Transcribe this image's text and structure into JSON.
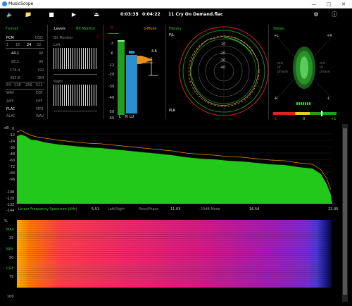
{
  "app": {
    "title": "MusicScope"
  },
  "toolbar": {
    "position": "0:03:35",
    "separator": "/",
    "duration": "0:04:22",
    "track": "11 Cry On Demand.flac"
  },
  "format": {
    "label": "Format",
    "pcm": "PCM",
    "dsd": "DSD",
    "bits": [
      "1",
      "16",
      "24",
      "32"
    ],
    "rates_left": [
      "44.1",
      "88.2",
      "176.4",
      "352.8"
    ],
    "rates_right": [
      "48",
      "96",
      "192",
      "384"
    ],
    "dsd_rates": [
      "64",
      "128",
      "256",
      "512"
    ],
    "containers_left": [
      "WAV",
      "AIFF",
      "FLAC",
      "ALAC"
    ],
    "containers_right": [
      "DSF",
      "DFF",
      "MP3",
      "WAV"
    ]
  },
  "levels": {
    "label": "Levels",
    "bit_monitor": "Bit Monitor",
    "bit_monitor_sub": "Bit Monitor",
    "left": "Left",
    "right": "Right",
    "meter_label": "S-Mode",
    "meter_ticks": [
      "0",
      "-3",
      "-6",
      "-12",
      "-20",
      "-30",
      "-40",
      "-50",
      "-60"
    ],
    "peak_value": "4.6",
    "channels": [
      "L",
      "R",
      "LU"
    ]
  },
  "history": {
    "label": "History",
    "pl": "P/L",
    "plr": "PLR",
    "rings": [
      "10",
      "-20",
      "-30",
      "-40"
    ]
  },
  "stereo": {
    "label": "Stereo",
    "plus_l": "+L",
    "plus_r": "+R",
    "minus_r": "-R",
    "minus_l": "-L",
    "out_left": "out of phase",
    "out_right": "out of phase",
    "corr_min": "-1",
    "corr_mid": "0",
    "corr_max": "+1"
  },
  "spectrum": {
    "y_unit": "dB",
    "y_ticks": [
      "0",
      "-12",
      "-24",
      "-36",
      "-48",
      "-60",
      "-72",
      "-84",
      "-96",
      "-108",
      "-120",
      "-132",
      "-144"
    ],
    "mode_label": "Linear Frequency Spectrum (kHz)",
    "x_ticks": [
      "5.51",
      "11.03",
      "16.54",
      "22.05"
    ],
    "options": [
      "Left/Right",
      "Pans/Phase",
      "-20dB Mode"
    ]
  },
  "spectrogram": {
    "y_unit": "%",
    "y_labels": [
      "MAX",
      "25",
      "BRY",
      "50",
      "CGF",
      "75",
      "100"
    ]
  },
  "colors": {
    "accent": "#33cc33",
    "meter_red": "#d22",
    "meter_orange": "#e8901a",
    "meter_blue": "#2a8fd0"
  }
}
